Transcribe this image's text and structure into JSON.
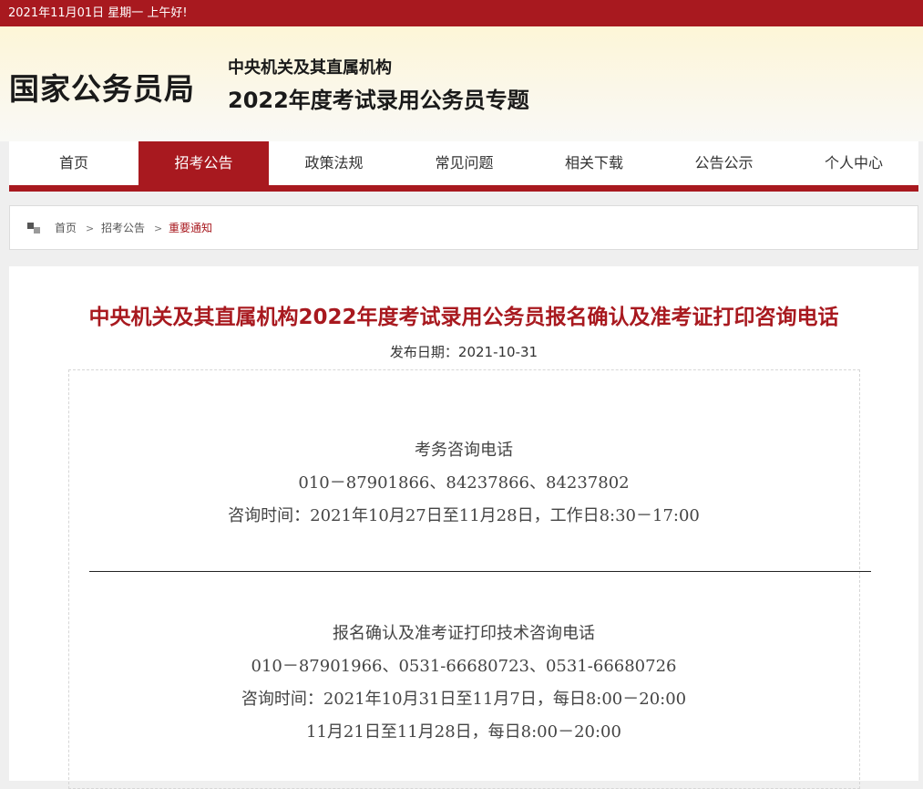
{
  "topbar": {
    "date_text": "2021年11月01日  星期一  上午好!"
  },
  "header": {
    "logo": "国家公务员局",
    "subtitle": "中央机关及其直属机构",
    "title": "2022年度考试录用公务员专题"
  },
  "nav": {
    "items": [
      {
        "label": "首页"
      },
      {
        "label": "招考公告"
      },
      {
        "label": "政策法规"
      },
      {
        "label": "常见问题"
      },
      {
        "label": "相关下载"
      },
      {
        "label": "公告公示"
      },
      {
        "label": "个人中心"
      }
    ],
    "active_index": 1
  },
  "breadcrumb": {
    "items": [
      "首页",
      "招考公告",
      "重要通知"
    ],
    "separator": ">"
  },
  "article": {
    "title": "中央机关及其直属机构2022年度考试录用公务员报名确认及准考证打印咨询电话",
    "pubdate": "发布日期：2021-10-31",
    "section1": {
      "heading": "考务咨询电话",
      "phones": "010－87901866、84237866、84237802",
      "hours": "咨询时间：2021年10月27日至11月28日，工作日8:30－17:00"
    },
    "section2": {
      "heading": "报名确认及准考证打印技术咨询电话",
      "phones": "010－87901966、0531-66680723、0531-66680726",
      "hours1": "咨询时间：2021年10月31日至11月7日，每日8:00－20:00",
      "hours2": "11月21日至11月28日，每日8:00－20:00"
    }
  },
  "colors": {
    "brand_red": "#a8191f",
    "title_red": "#a8191f",
    "page_bg": "#efefef"
  }
}
